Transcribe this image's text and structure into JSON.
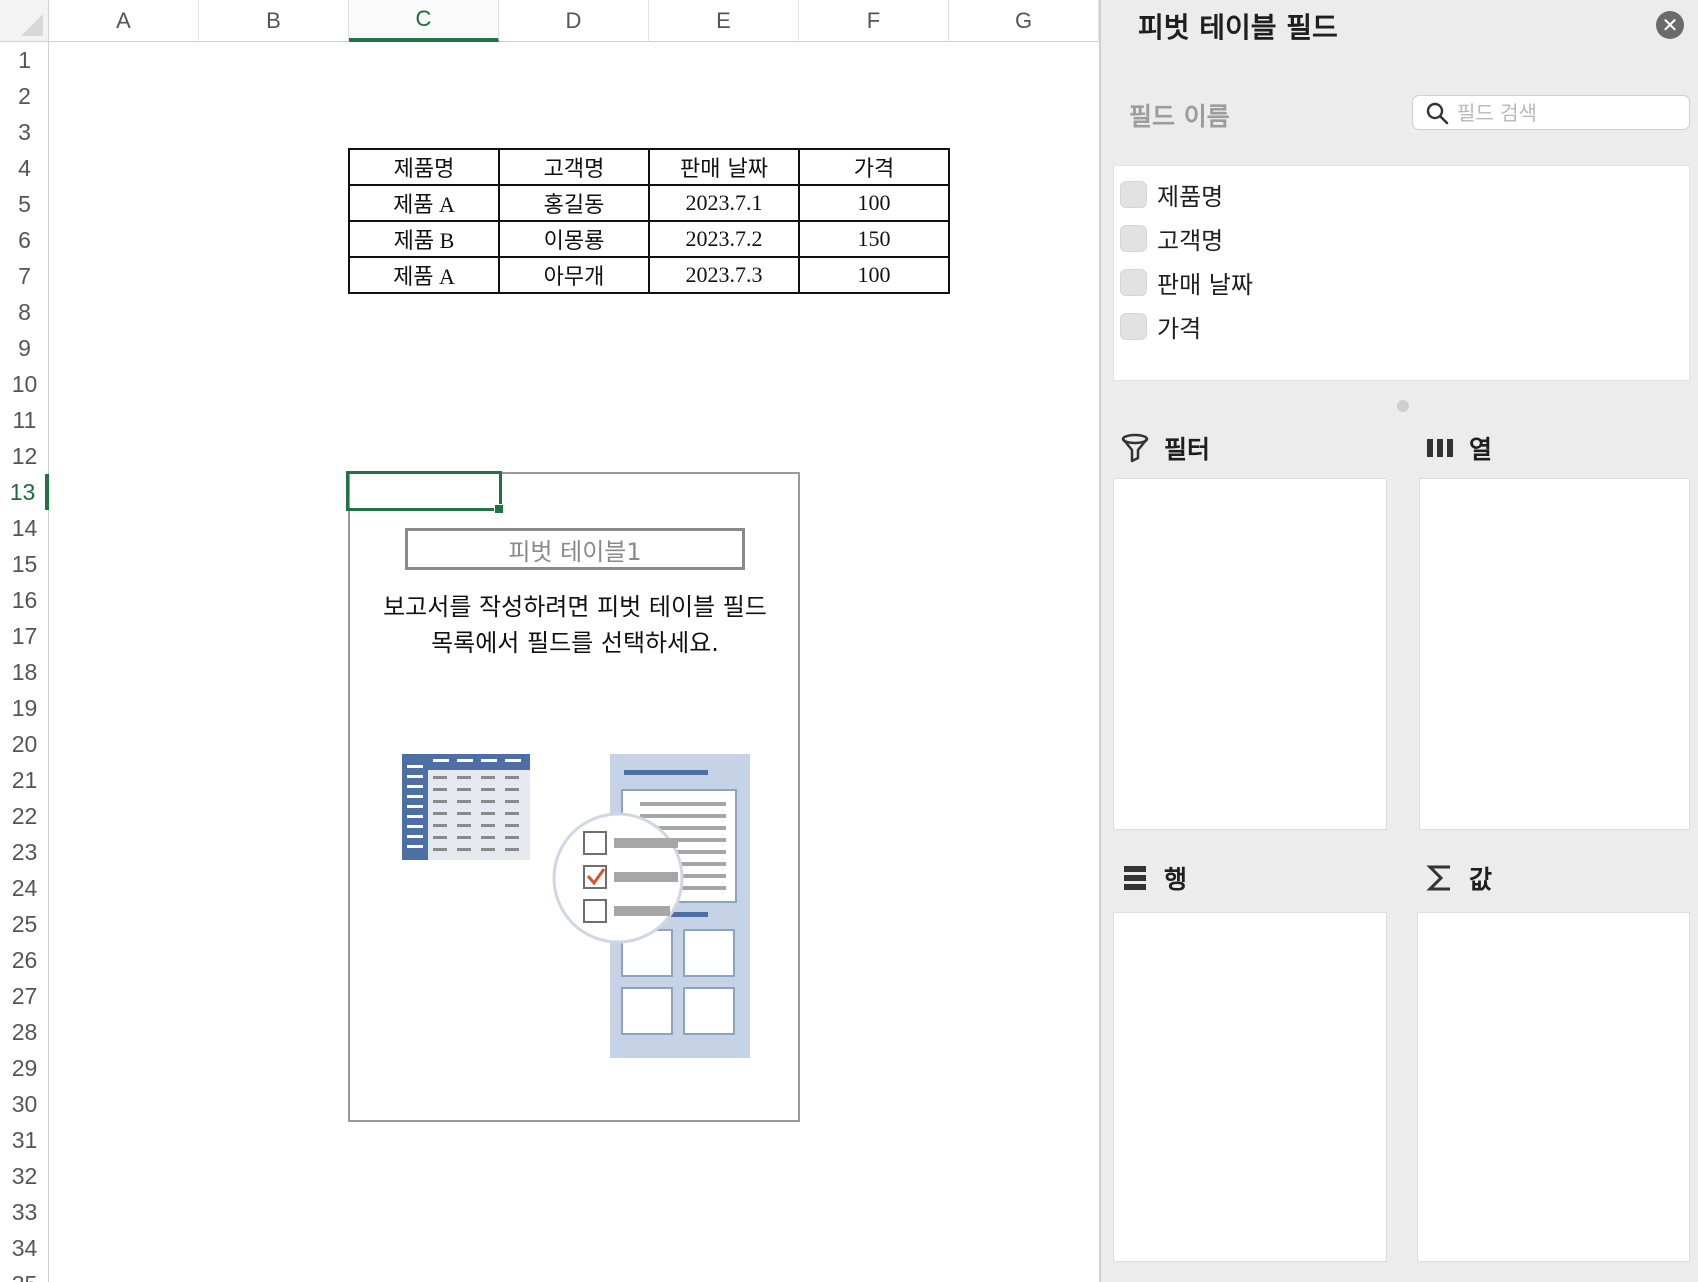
{
  "sheet": {
    "columns": [
      "A",
      "B",
      "C",
      "D",
      "E",
      "F",
      "G"
    ],
    "active_column": "C",
    "rows": [
      "1",
      "2",
      "3",
      "4",
      "5",
      "6",
      "7",
      "8",
      "9",
      "10",
      "11",
      "12",
      "13",
      "14",
      "15",
      "16",
      "17",
      "18",
      "19",
      "20",
      "21",
      "22",
      "23",
      "24",
      "25",
      "26",
      "27",
      "28",
      "29",
      "30",
      "31",
      "32",
      "33",
      "34",
      "35"
    ],
    "active_row": "13",
    "table": [
      [
        "제품명",
        "고객명",
        "판매 날짜",
        "가격"
      ],
      [
        "제품 A",
        "홍길동",
        "2023.7.1",
        "100"
      ],
      [
        "제품 B",
        "이몽룡",
        "2023.7.2",
        "150"
      ],
      [
        "제품 A",
        "아무개",
        "2023.7.3",
        "100"
      ]
    ],
    "pivot": {
      "title": "피벗 테이블1",
      "instruction_line1": "보고서를 작성하려면 피벗 테이블 필드",
      "instruction_line2": "목록에서 필드를 선택하세요."
    },
    "accent_color": "#217346"
  },
  "pane": {
    "title": "피벗 테이블 필드",
    "close_icon": "close-icon",
    "field_name_label": "필드 이름",
    "search_placeholder": "필드 검색",
    "fields": [
      "제품명",
      "고객명",
      "판매 날짜",
      "가격"
    ],
    "areas": {
      "filter": "필터",
      "columns": "열",
      "rows": "행",
      "values": "값"
    },
    "icons": {
      "filter": "funnel-icon",
      "columns": "columns-icon",
      "rows": "rows-icon",
      "values": "sigma-icon"
    }
  }
}
